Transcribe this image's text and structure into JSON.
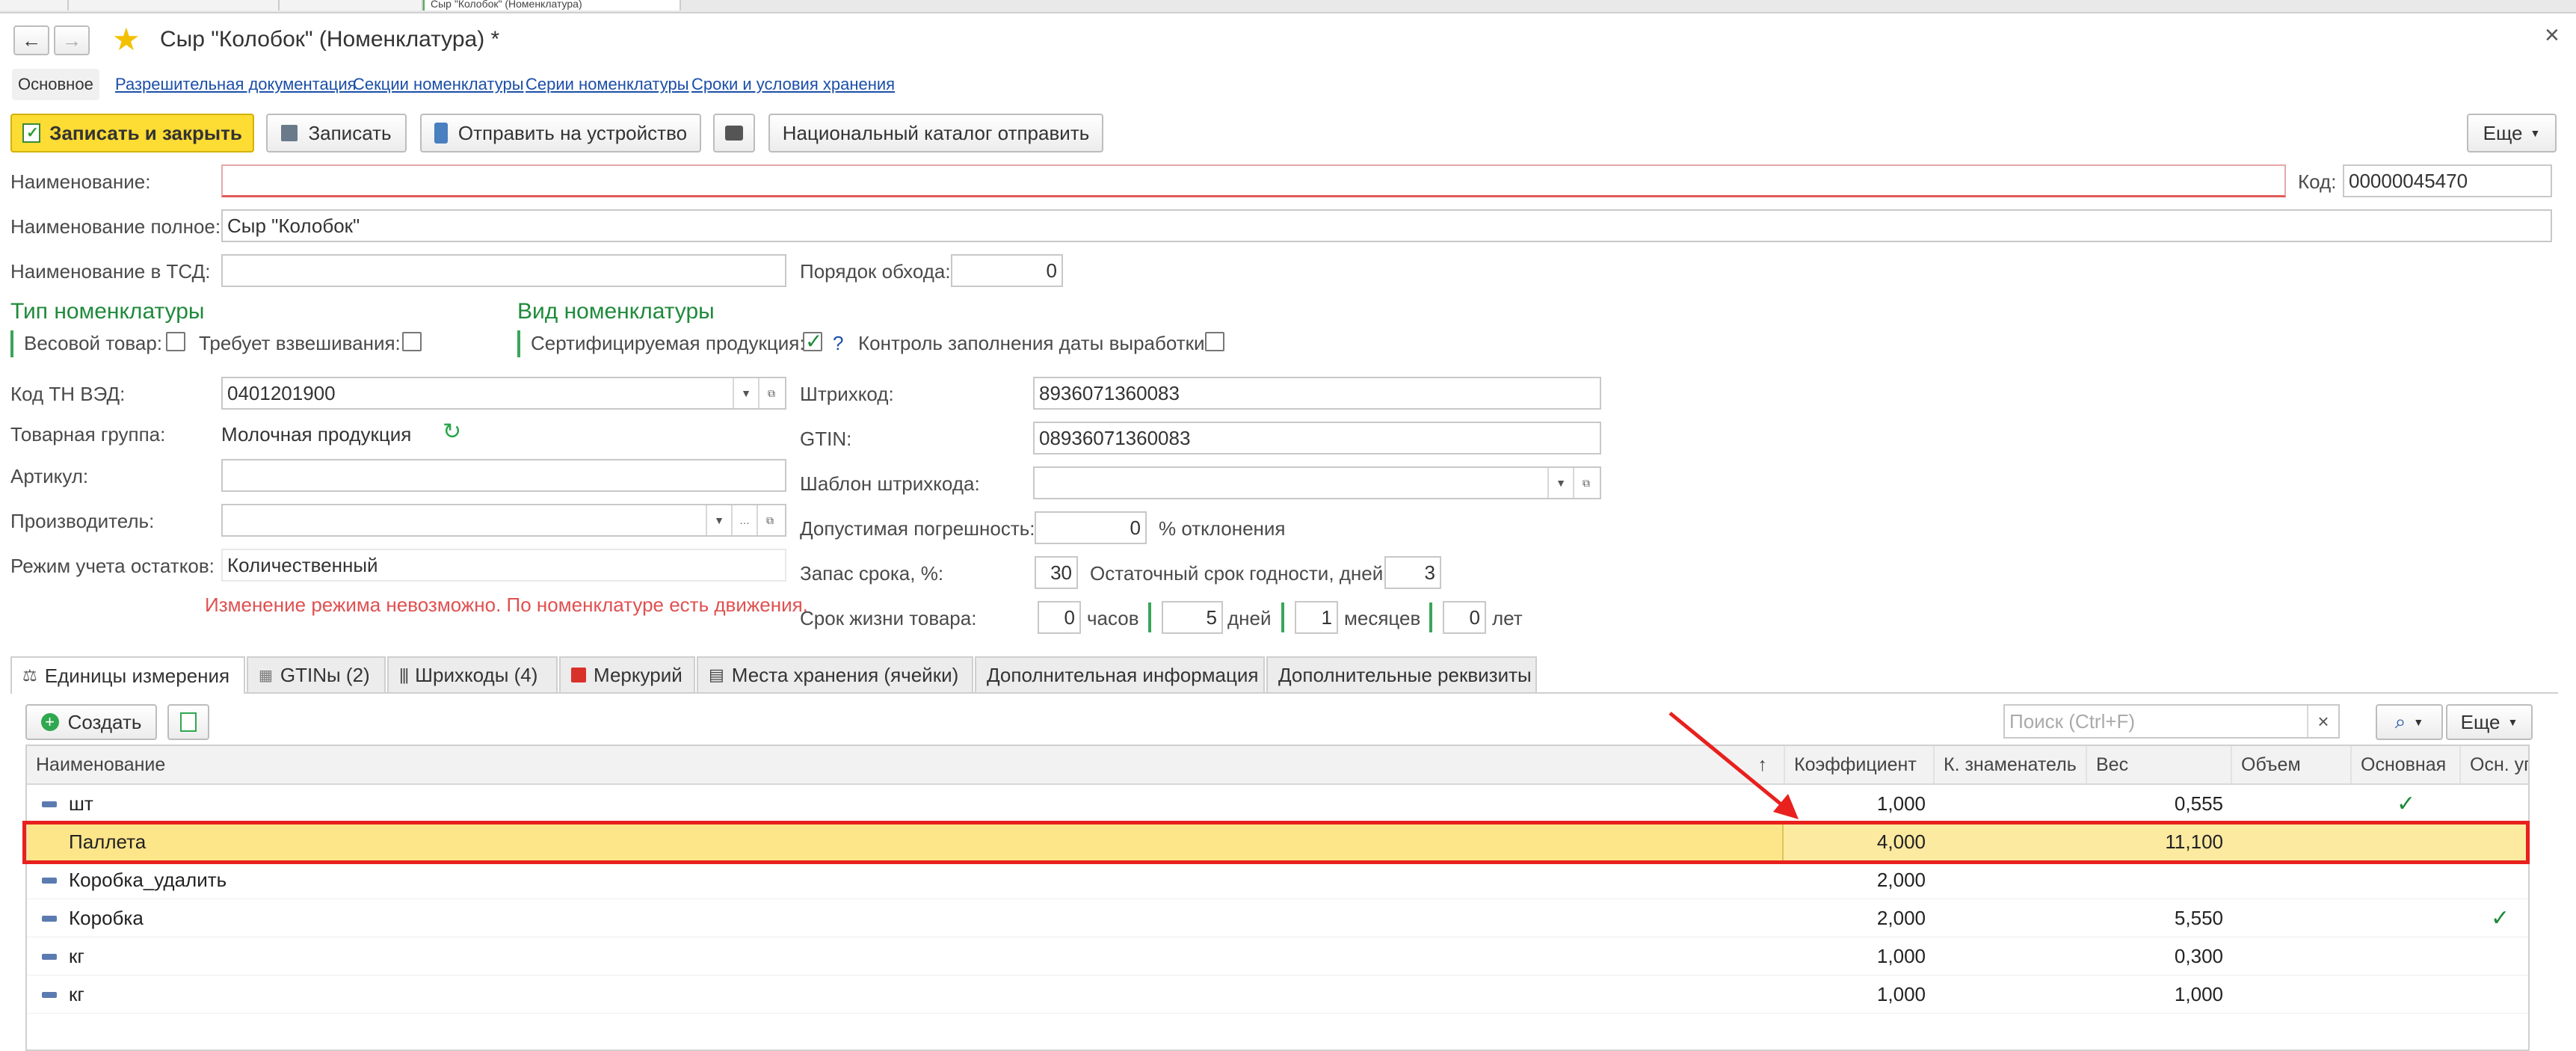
{
  "window": {
    "tabs": [
      "Сыр \"Колобок\" (Номенклатура)"
    ],
    "title": "Сыр \"Колобок\" (Номенклатура) *",
    "close_glyph": "×"
  },
  "nav_links": {
    "main": "Основное",
    "links": [
      "Разрешительная документация",
      "Секции номенклатуры",
      "Серии номенклатуры",
      "Сроки и условия хранения"
    ]
  },
  "toolbar": {
    "save_close": "Записать и закрыть",
    "save": "Записать",
    "send_device": "Отправить на устройство",
    "national_catalog": "Национальный каталог отправить",
    "more": "Еще"
  },
  "form": {
    "name_label": "Наименование:",
    "name_value": "",
    "code_label": "Код:",
    "code_value": "00000045470",
    "full_name_label": "Наименование полное:",
    "full_name_value": "Сыр \"Колобок\"",
    "tsd_name_label": "Наименование в ТСД:",
    "tsd_name_value": "",
    "order_label": "Порядок обхода:",
    "order_value": "0",
    "type_title": "Тип номенклатуры",
    "weight_label": "Весовой товар:",
    "needs_weigh_label": "Требует взвешивания:",
    "kind_title": "Вид номенклатуры",
    "certified_label": "Сертифицируемая продукция:",
    "help_mark": "?",
    "prod_date_label": "Контроль заполнения даты выработки:",
    "tnved_label": "Код ТН ВЭД:",
    "tnved_value": "0401201900",
    "group_label": "Товарная группа:",
    "group_value": "Молочная продукция",
    "article_label": "Артикул:",
    "article_value": "",
    "manufacturer_label": "Производитель:",
    "manufacturer_value": "",
    "stock_mode_label": "Режим учета остатков:",
    "stock_mode_value": "Количественный",
    "warning": "Изменение режима невозможно. По номенклатуре есть движения.",
    "barcode_label": "Штрихкод:",
    "barcode_value": "8936071360083",
    "gtin_label": "GTIN:",
    "gtin_value": "08936071360083",
    "barcode_tpl_label": "Шаблон штрихкода:",
    "barcode_tpl_value": "",
    "tolerance_label": "Допустимая погрешность:",
    "tolerance_value": "0",
    "tolerance_unit": "% отклонения",
    "reserve_label": "Запас срока, %:",
    "reserve_value": "30",
    "remaining_label": "Остаточный срок годности, дней:",
    "remaining_value": "3",
    "life_label": "Срок жизни товара:",
    "life_hours": "0",
    "hours_unit": "часов",
    "life_days": "5",
    "days_unit": "дней",
    "life_months": "1",
    "months_unit": "месяцев",
    "life_years": "0",
    "years_unit": "лет"
  },
  "tabs": [
    "Единицы измерения",
    "GTINы (2)",
    "Шрихкоды (4)",
    "Меркурий",
    "Места хранения (ячейки)",
    "Дополнительная информация",
    "Дополнительные реквизиты"
  ],
  "table_toolbar": {
    "create": "Создать",
    "search_placeholder": "Поиск (Ctrl+F)",
    "more": "Еще"
  },
  "table": {
    "headers": [
      "Наименование",
      "Коэффициент",
      "К. знаменатель",
      "Вес",
      "Объем",
      "Основная",
      "Осн. уп."
    ],
    "sort_arrow": "↑",
    "rows": [
      {
        "name": "шт",
        "coef": "1,000",
        "denom": "",
        "weight": "0,555",
        "volume": "",
        "main": true,
        "pack": false
      },
      {
        "name": "Паллета",
        "coef": "4,000",
        "denom": "",
        "weight": "11,100",
        "volume": "",
        "main": false,
        "pack": false
      },
      {
        "name": "Коробка_удалить",
        "coef": "2,000",
        "denom": "",
        "weight": "",
        "volume": "",
        "main": false,
        "pack": false
      },
      {
        "name": "Коробка",
        "coef": "2,000",
        "denom": "",
        "weight": "5,550",
        "volume": "",
        "main": false,
        "pack": true
      },
      {
        "name": "кг",
        "coef": "1,000",
        "denom": "",
        "weight": "0,300",
        "volume": "",
        "main": false,
        "pack": false
      },
      {
        "name": "кг",
        "coef": "1,000",
        "denom": "",
        "weight": "1,000",
        "volume": "",
        "main": false,
        "pack": false
      }
    ]
  },
  "colors": {
    "accent_yellow": "#fddc34",
    "highlight_row": "#fbeaa0",
    "annotation_red": "#e8201e",
    "green": "#1f8a3b"
  }
}
